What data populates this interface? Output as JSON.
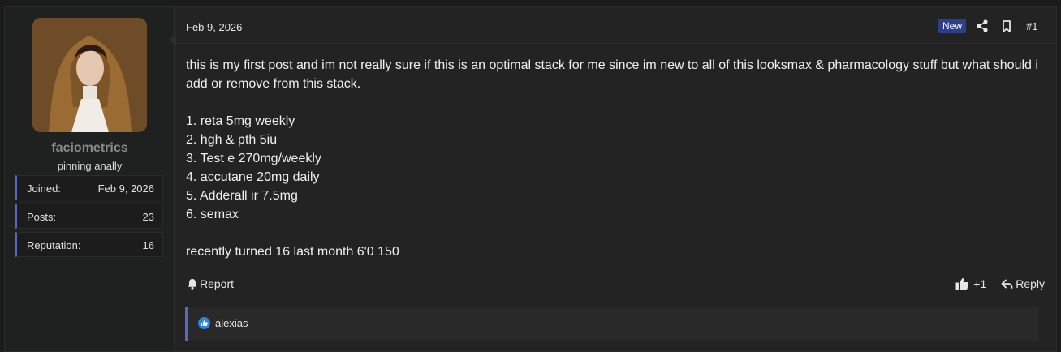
{
  "user": {
    "username": "faciometrics",
    "title": "pinning anally",
    "avatar_icon": "avatar-image",
    "stats": [
      {
        "label": "Joined:",
        "value": "Feb 9, 2026"
      },
      {
        "label": "Posts:",
        "value": "23"
      },
      {
        "label": "Reputation:",
        "value": "16"
      }
    ]
  },
  "post": {
    "date": "Feb 9, 2026",
    "badge": "New",
    "number": "#1",
    "icons": {
      "share": "share-icon",
      "bookmark": "bookmark-icon"
    },
    "lines": [
      "this is my first post and im not really sure if this is an optimal stack for me since im new to all of this looksmax & pharmacology stuff but what should i add or remove from this stack.",
      "1. reta 5mg weekly",
      "2. hgh & pth 5iu",
      "3. Test e 270mg/weekly",
      "4. accutane 20mg daily",
      "5. Adderall ir 7.5mg",
      "6. semax",
      "recently turned 16 last month 6'0 150"
    ]
  },
  "footer": {
    "report_label": "Report",
    "like_count": "+1",
    "reply_label": "Reply"
  },
  "reactions": {
    "user": "alexias",
    "icon": "like-reaction-icon"
  },
  "colors": {
    "accent": "#5967c7",
    "badge_bg": "#2d3e8a",
    "reaction_blue": "#2d86e0",
    "username": "#8a8a8a"
  }
}
